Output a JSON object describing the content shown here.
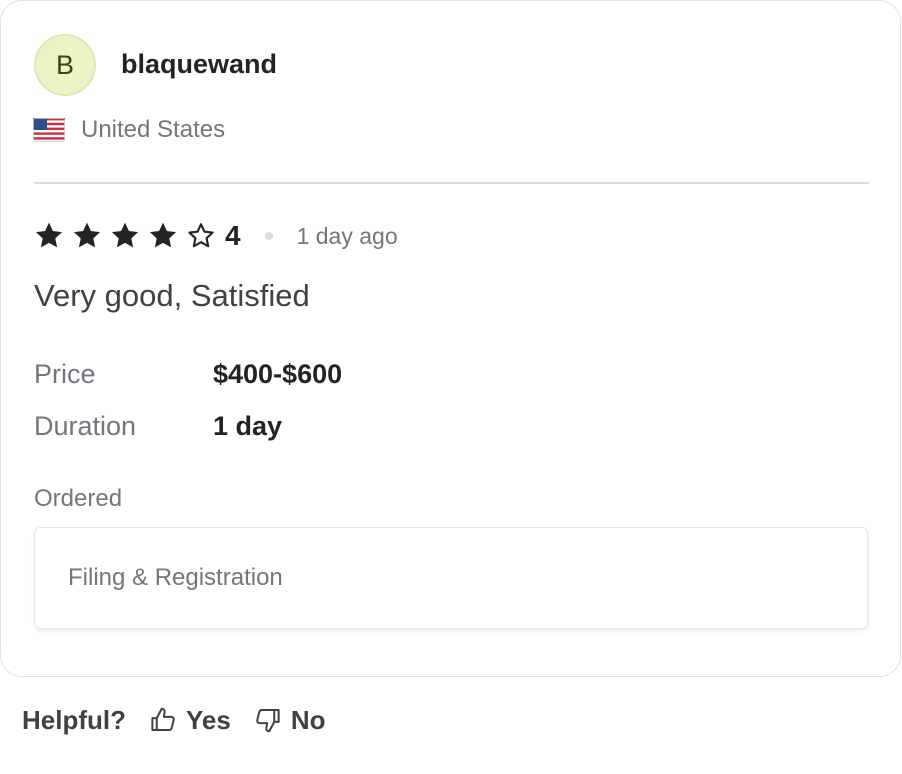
{
  "review": {
    "avatar_initial": "B",
    "username": "blaquewand",
    "country": "United States",
    "flag_icon": "us-flag-icon",
    "rating": {
      "value": "4",
      "stars_filled": 4,
      "stars_total": 5,
      "time_ago": "1 day ago"
    },
    "text": "Very good, Satisfied",
    "details": {
      "price_label": "Price",
      "price_value": "$400-$600",
      "duration_label": "Duration",
      "duration_value": "1 day"
    },
    "ordered": {
      "label": "Ordered",
      "item": "Filing & Registration"
    }
  },
  "helpful": {
    "label": "Helpful?",
    "yes": "Yes",
    "no": "No",
    "yes_icon": "thumbs-up-icon",
    "no_icon": "thumbs-down-icon"
  },
  "colors": {
    "avatar_bg": "#eef3c5",
    "text_primary": "#222325",
    "text_secondary": "#74767e",
    "border": "#e0e0e0"
  }
}
